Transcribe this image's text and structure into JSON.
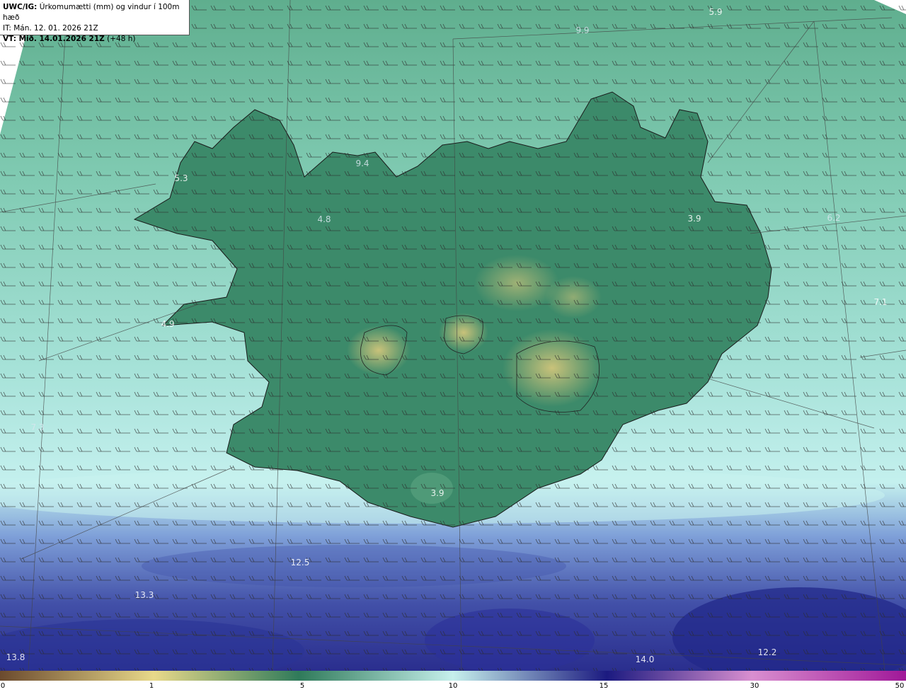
{
  "header": {
    "model": "UWC/IG:",
    "title": "Úrkomumætti (mm) og vindur í 100m hæð",
    "it": "IT: Mán. 12. 01. 2026 21Z",
    "vt_bold": "VT: Mið. 14.01.2026 21Z",
    "vt_lead": "(+48 h)"
  },
  "labels": [
    {
      "text": "5.9"
    },
    {
      "text": "9.9"
    },
    {
      "text": "5.3"
    },
    {
      "text": "9.4"
    },
    {
      "text": "4.8"
    },
    {
      "text": "3.9"
    },
    {
      "text": "6.2"
    },
    {
      "text": "7.1"
    },
    {
      "text": "4.9"
    },
    {
      "text": "7.3"
    },
    {
      "text": "3.9"
    },
    {
      "text": "12.5"
    },
    {
      "text": "13.3"
    },
    {
      "text": "13.8"
    },
    {
      "text": "14.0"
    },
    {
      "text": "12.2"
    }
  ],
  "colorbar": {
    "ticks": [
      "0",
      "1",
      "5",
      "10",
      "15",
      "30",
      "50"
    ],
    "colors": [
      "#6b4a2e",
      "#e8d98a",
      "#2f7a5a",
      "#c6f0ec",
      "#1b1a80",
      "#d98fd0",
      "#a01898"
    ]
  },
  "map_colors": {
    "land_green": "#3f8f6d",
    "land_yellow": "#b8b96a",
    "sea_teal": "#7ec9b8",
    "sea_cyan": "#bdeee8",
    "sea_blue": "#4b5fb0",
    "sea_dark": "#232a8c"
  }
}
